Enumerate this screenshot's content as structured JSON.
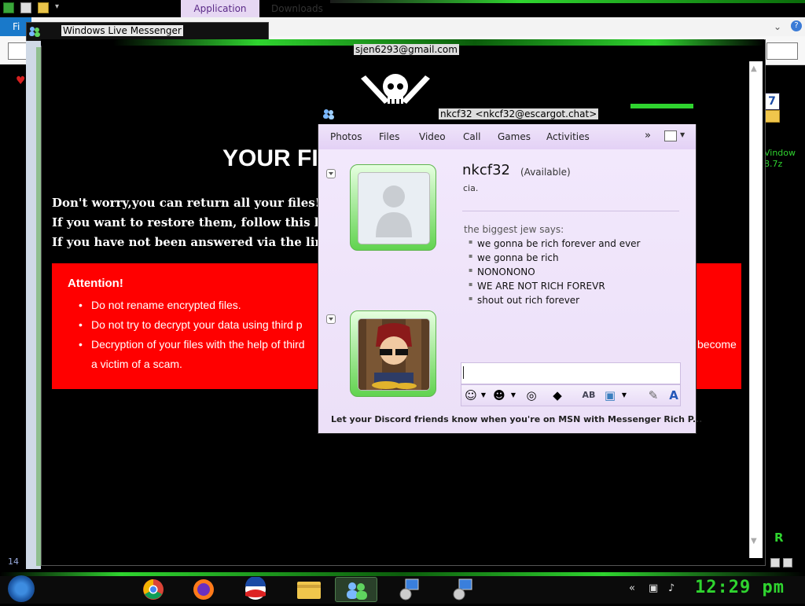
{
  "explorer": {
    "ribbon_tab": "Application Tools",
    "downloads_tab": "Downloads",
    "file_tab": "Fi",
    "status_count": "14",
    "right_label": "Vindow\n8.7z",
    "right_icon_number": "7",
    "help_glyph": "?",
    "chevron": "⌄"
  },
  "messenger_window": {
    "title": "Windows Live Messenger",
    "account": "sjen6293@gmail.com"
  },
  "ransom": {
    "title": "YOUR FI",
    "lines": [
      "Don't worry,you can return all your files!",
      "If you want to restore them, follow this link:",
      "If you have not been answered via the link wi"
    ],
    "attention_title": "Attention!",
    "attention_items": [
      "Do not rename encrypted files.",
      "Do not try to decrypt your data using third p",
      "Decryption of your files with the help of third"
    ],
    "attention_item3_tail": "become",
    "attention_item3_wrap": "a victim of a scam."
  },
  "chat": {
    "title": "nkcf32 <nkcf32@escargot.chat>",
    "toolbar": [
      "Photos",
      "Files",
      "Video",
      "Call",
      "Games",
      "Activities"
    ],
    "toolbar_more": "»",
    "contact_name": "nkcf32",
    "contact_status": "(Available)",
    "personal_message": "cia.",
    "sender_line": "the biggest jew says:",
    "messages": [
      "we gonna be rich forever and ever",
      "we gonna be rich",
      "NONONONO",
      "WE ARE NOT RICH FOREVR",
      "shout out rich forever"
    ],
    "input_value": "",
    "ad_text": "Let your Discord friends know when you're on MSN with Messenger Rich P..."
  },
  "taskbar": {
    "clock": "12:29 pm",
    "right_tray_text": "R"
  },
  "colors": {
    "accent_green": "#2fd42f",
    "attention_red": "#ff0000",
    "chat_bg": "#f1e7fb"
  }
}
